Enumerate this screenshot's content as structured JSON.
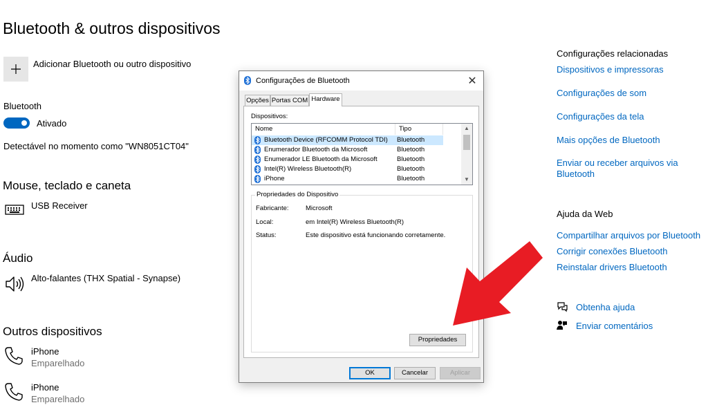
{
  "page": {
    "title": "Bluetooth & outros dispositivos",
    "add_device_label": "Adicionar Bluetooth ou outro dispositivo",
    "bluetooth_label": "Bluetooth",
    "toggle_label": "Ativado",
    "discoverable_text": "Detectável no momento como \"WN8051CT04\""
  },
  "sections": {
    "mouse": {
      "heading": "Mouse, teclado e caneta",
      "devices": [
        {
          "name": "USB Receiver",
          "icon": "keyboard-icon"
        }
      ]
    },
    "audio": {
      "heading": "Áudio",
      "devices": [
        {
          "name": "Alto-falantes (THX Spatial - Synapse)",
          "icon": "speaker-icon"
        }
      ]
    },
    "other": {
      "heading": "Outros dispositivos",
      "devices": [
        {
          "name": "iPhone",
          "status": "Emparelhado",
          "icon": "phone-icon"
        },
        {
          "name": "iPhone",
          "status": "Emparelhado",
          "icon": "phone-icon"
        }
      ]
    }
  },
  "related": {
    "heading": "Configurações relacionadas",
    "links": [
      "Dispositivos e impressoras",
      "Configurações de som",
      "Configurações da tela",
      "Mais opções de Bluetooth",
      "Enviar ou receber arquivos via Bluetooth"
    ]
  },
  "web_help": {
    "heading": "Ajuda da Web",
    "links": [
      "Compartilhar arquivos por Bluetooth",
      "Corrigir conexões Bluetooth",
      "Reinstalar drivers Bluetooth"
    ]
  },
  "support": {
    "help_label": "Obtenha ajuda",
    "feedback_label": "Enviar comentários"
  },
  "dialog": {
    "title": "Configurações de Bluetooth",
    "tabs": [
      "Opções",
      "Portas COM",
      "Hardware"
    ],
    "active_tab": "Hardware",
    "devices_label": "Dispositivos:",
    "columns": [
      "Nome",
      "Tipo"
    ],
    "rows": [
      {
        "name": "Bluetooth Device (RFCOMM Protocol TDI)",
        "type": "Bluetooth"
      },
      {
        "name": "Enumerador Bluetooth da Microsoft",
        "type": "Bluetooth"
      },
      {
        "name": "Enumerador LE Bluetooth da Microsoft",
        "type": "Bluetooth"
      },
      {
        "name": "Intel(R) Wireless Bluetooth(R)",
        "type": "Bluetooth"
      },
      {
        "name": "iPhone",
        "type": "Bluetooth"
      }
    ],
    "properties_title": "Propriedades do Dispositivo",
    "properties": [
      {
        "label": "Fabricante:",
        "value": "Microsoft"
      },
      {
        "label": "Local:",
        "value": "em Intel(R) Wireless Bluetooth(R)"
      },
      {
        "label": "Status:",
        "value": "Este dispositivo está funcionando corretamente."
      }
    ],
    "properties_button": "Propriedades",
    "ok_button": "OK",
    "cancel_button": "Cancelar",
    "apply_button": "Aplicar"
  },
  "colors": {
    "accent": "#0067c0",
    "arrow": "#e81c24",
    "selection": "#cce8ff"
  }
}
